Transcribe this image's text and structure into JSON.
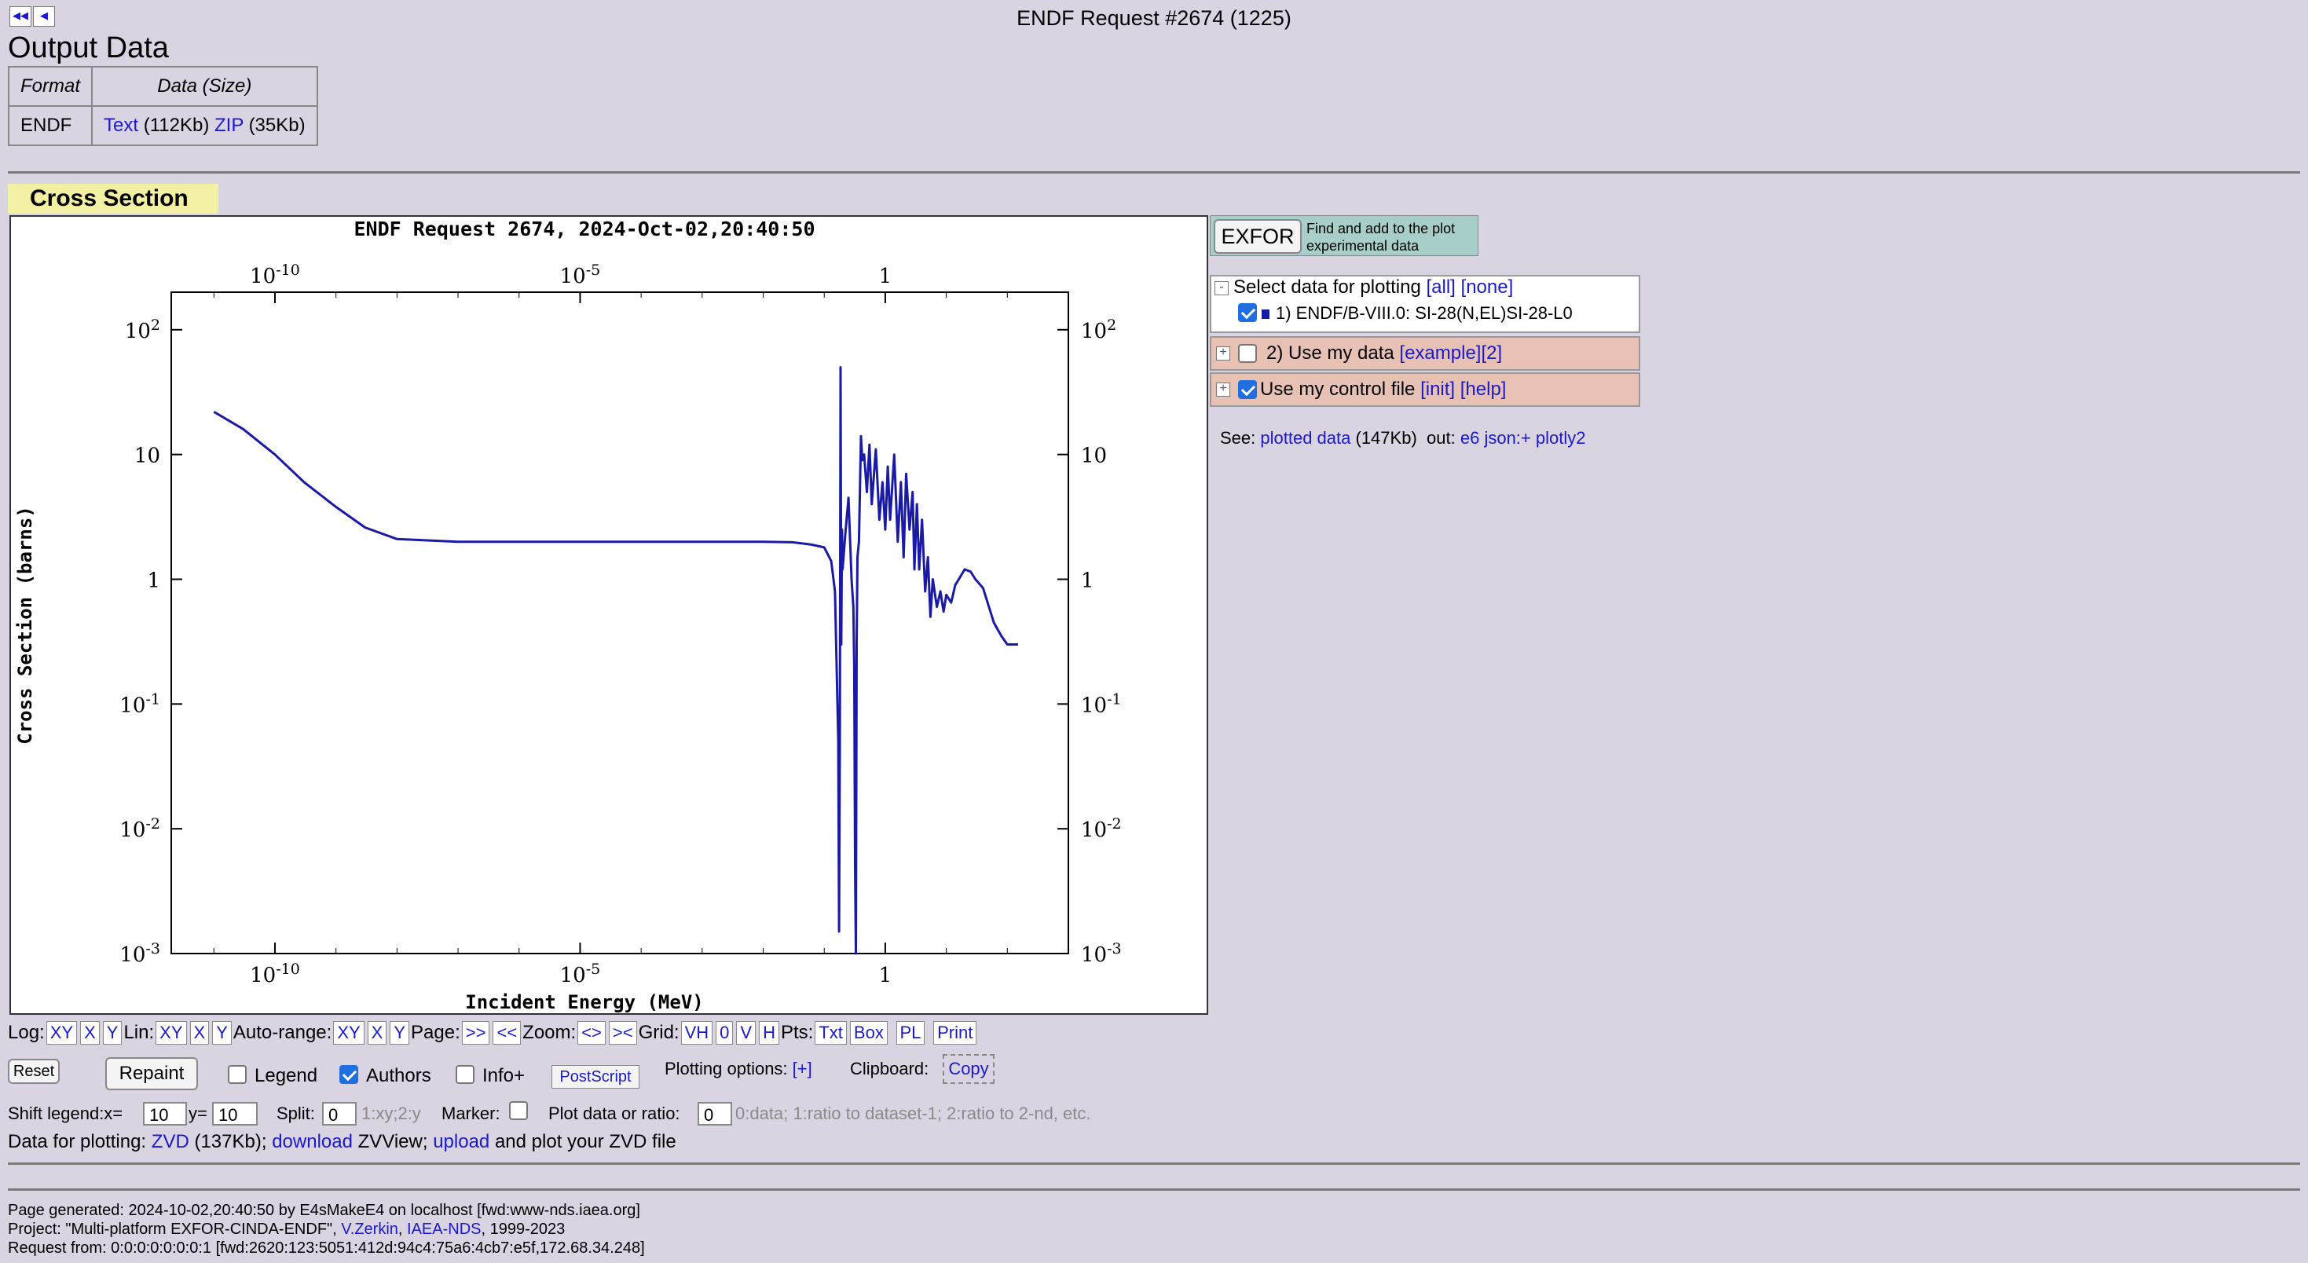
{
  "nav": {
    "first": "◀◀",
    "prev": "◀"
  },
  "header": {
    "title": "ENDF Request #2674 (1225)"
  },
  "output": {
    "heading": "Output Data",
    "col_format": "Format",
    "col_data": "Data (Size)",
    "row_format": "ENDF",
    "text_link": "Text",
    "text_size": "(112Kb)",
    "zip_link": "ZIP",
    "zip_size": "(35Kb)"
  },
  "section": {
    "title": "Cross Section"
  },
  "chart_data": {
    "type": "line",
    "title": "ENDF Request 2674, 2024-Oct-02,20:40:50",
    "xlabel": "Incident Energy (MeV)",
    "ylabel": "Cross Section (barns)",
    "xscale": "log",
    "yscale": "log",
    "xlim": [
      2e-12,
      1000
    ],
    "ylim": [
      0.001,
      200
    ],
    "xticks": [
      {
        "v": 1e-10,
        "m": "10",
        "e": "-10"
      },
      {
        "v": 1e-05,
        "m": "10",
        "e": "-5"
      },
      {
        "v": 1,
        "m": "1",
        "e": ""
      }
    ],
    "yticks": [
      {
        "v": 100,
        "m": "10",
        "e": "2"
      },
      {
        "v": 10,
        "m": "10",
        "e": ""
      },
      {
        "v": 1,
        "m": "1",
        "e": ""
      },
      {
        "v": 0.1,
        "m": "10",
        "e": "-1"
      },
      {
        "v": 0.01,
        "m": "10",
        "e": "-2"
      },
      {
        "v": 0.001,
        "m": "10",
        "e": "-3"
      }
    ],
    "series": [
      {
        "color": "#1a1aa6",
        "x": [
          1e-11,
          3e-11,
          1e-10,
          3e-10,
          1e-09,
          3e-09,
          1e-08,
          1e-07,
          1e-06,
          1e-05,
          0.0001,
          0.001,
          0.01,
          0.03,
          0.06,
          0.1,
          0.13,
          0.15,
          0.17,
          0.175,
          0.18,
          0.185,
          0.19,
          0.195,
          0.2,
          0.22,
          0.25,
          0.28,
          0.3,
          0.31,
          0.32,
          0.33,
          0.34,
          0.35,
          0.37,
          0.4,
          0.42,
          0.45,
          0.5,
          0.55,
          0.6,
          0.7,
          0.8,
          0.9,
          1.0,
          1.1,
          1.2,
          1.4,
          1.6,
          1.8,
          2,
          2.2,
          2.5,
          2.8,
          3,
          3.3,
          3.6,
          4,
          4.5,
          5,
          5.5,
          6,
          7,
          8,
          9,
          10,
          12,
          14,
          16,
          18,
          20,
          25,
          30,
          40,
          50,
          60,
          80,
          100,
          150
        ],
        "y": [
          22,
          16,
          10,
          6,
          3.8,
          2.6,
          2.1,
          2.0,
          2.0,
          2.0,
          2.0,
          2.0,
          2.0,
          1.98,
          1.9,
          1.8,
          1.4,
          0.8,
          0.05,
          0.0015,
          0.05,
          50,
          0.3,
          2.5,
          1.2,
          2.2,
          4.5,
          1.0,
          0.6,
          0.2,
          0.005,
          0.001,
          0.3,
          1.5,
          2.0,
          14,
          9,
          10,
          5,
          12,
          4,
          11,
          3,
          6,
          2.5,
          8,
          3,
          10,
          2,
          6,
          1.5,
          7,
          2.5,
          5,
          1.2,
          4,
          1.2,
          3,
          0.8,
          1.5,
          0.5,
          1.0,
          0.6,
          0.8,
          0.55,
          0.75,
          0.65,
          0.9,
          1.0,
          1.1,
          1.2,
          1.15,
          1.0,
          0.85,
          0.6,
          0.45,
          0.35,
          0.3,
          0.3
        ]
      }
    ]
  },
  "exfor": {
    "button": "EXFOR",
    "hint": "Find and add to the plot experimental data"
  },
  "select": {
    "toggle": "-",
    "label": "Select data for plotting",
    "all": "[all]",
    "none": "[none]",
    "item1": "1) ENDF/B-VIII.0: SI-28(N,EL)SI-28-L0"
  },
  "mydata": {
    "toggle": "+",
    "label": "2) Use my data",
    "example": "[example]",
    "two": "[2]"
  },
  "control": {
    "toggle": "+",
    "label": "Use my control file",
    "init": "[init]",
    "help": "[help]"
  },
  "see": {
    "label": "See:",
    "plotted": "plotted data",
    "size": "(147Kb)",
    "out": "out:",
    "e6": "e6",
    "json": "json:+",
    "plotly": "plotly2"
  },
  "toolbar": {
    "log": "Log:",
    "lin": "Lin:",
    "autorange": "Auto-range:",
    "page": "Page:",
    "zoom": "Zoom:",
    "grid": "Grid:",
    "pts": "Pts:",
    "xy": "XY",
    "x": "X",
    "y": "Y",
    "next": ">>",
    "prev": "<<",
    "zin": "<>",
    "zout": "><",
    "vh": "VH",
    "zero": "0",
    "v": "V",
    "h": "H",
    "txt": "Txt",
    "box": "Box",
    "pl": "PL",
    "print": "Print"
  },
  "controls": {
    "reset": "Reset",
    "repaint": "Repaint",
    "legend": "Legend",
    "authors": "Authors",
    "info": "Info+",
    "postscript": "PostScript",
    "plot_options": "Plotting options:",
    "plot_options_link": "[+]",
    "clipboard": "Clipboard:",
    "copy": "Copy"
  },
  "shift": {
    "label": "Shift legend:x=",
    "x": "10",
    "y_label": "y=",
    "y": "10",
    "split": "Split:",
    "split_val": "0",
    "split_hint": "1:xy;2:y",
    "marker": "Marker:",
    "ratio": "Plot data or ratio:",
    "ratio_val": "0",
    "ratio_hint": "0:data; 1:ratio to dataset-1; 2:ratio to 2-nd, etc."
  },
  "zvd": {
    "label": "Data for plotting:",
    "zvd": "ZVD",
    "size": "(137Kb);",
    "download": "download",
    "zvview": "ZVView;",
    "upload": "upload",
    "rest": "and plot your ZVD file"
  },
  "footer": {
    "line1": "Page generated: 2024-10-02,20:40:50 by E4sMakeE4 on localhost [fwd:www-nds.iaea.org]",
    "line2a": "Project: \"Multi-platform EXFOR-CINDA-ENDF\",",
    "author": "V.Zerkin",
    "comma": ",",
    "org": "IAEA-NDS",
    "line2b": ", 1999-2023",
    "line3": "Request from: 0:0:0:0:0:0:0:1 [fwd:2620:123:5051:412d:94c4:75a6:4cb7:e5f,172.68.34.248]"
  }
}
